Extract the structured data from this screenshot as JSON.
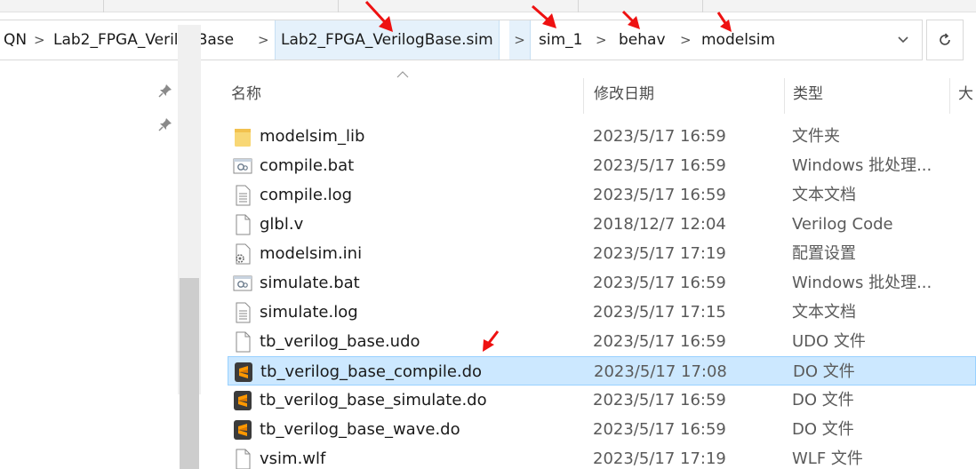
{
  "address_bar": {
    "crumbs": [
      {
        "label": "QN"
      },
      {
        "label": "Lab2_FPGA_VerilogBase"
      },
      {
        "label": "Lab2_FPGA_VerilogBase.sim"
      },
      {
        "label": "sim_1"
      },
      {
        "label": "behav"
      },
      {
        "label": "modelsim"
      }
    ],
    "separator": ">",
    "dropdown_icon": "chevron-down-icon",
    "refresh_icon": "refresh-icon"
  },
  "nav_pane": {
    "pin_icon": "pin-icon",
    "scroll_up_icon": "chevron-up-icon"
  },
  "columns": {
    "name": "名称",
    "date": "修改日期",
    "type": "类型",
    "size": "大"
  },
  "files": [
    {
      "name": "modelsim_lib",
      "date": "2023/5/17 16:59",
      "type": "文件夹",
      "icon": "folder-icon"
    },
    {
      "name": "compile.bat",
      "date": "2023/5/17 16:59",
      "type": "Windows 批处理...",
      "icon": "batch-file-icon"
    },
    {
      "name": "compile.log",
      "date": "2023/5/17 16:59",
      "type": "文本文档",
      "icon": "text-file-icon"
    },
    {
      "name": "glbl.v",
      "date": "2018/12/7 12:04",
      "type": "Verilog Code",
      "icon": "file-icon"
    },
    {
      "name": "modelsim.ini",
      "date": "2023/5/17 17:19",
      "type": "配置设置",
      "icon": "settings-file-icon"
    },
    {
      "name": "simulate.bat",
      "date": "2023/5/17 16:59",
      "type": "Windows 批处理...",
      "icon": "batch-file-icon"
    },
    {
      "name": "simulate.log",
      "date": "2023/5/17 17:15",
      "type": "文本文档",
      "icon": "text-file-icon"
    },
    {
      "name": "tb_verilog_base.udo",
      "date": "2023/5/17 16:59",
      "type": "UDO 文件",
      "icon": "file-icon"
    },
    {
      "name": "tb_verilog_base_compile.do",
      "date": "2023/5/17 17:08",
      "type": "DO 文件",
      "icon": "sublime-file-icon",
      "selected": true
    },
    {
      "name": "tb_verilog_base_simulate.do",
      "date": "2023/5/17 16:59",
      "type": "DO 文件",
      "icon": "sublime-file-icon"
    },
    {
      "name": "tb_verilog_base_wave.do",
      "date": "2023/5/17 16:59",
      "type": "DO 文件",
      "icon": "sublime-file-icon"
    },
    {
      "name": "vsim.wlf",
      "date": "2023/5/17 17:19",
      "type": "WLF 文件",
      "icon": "file-icon"
    }
  ],
  "colors": {
    "selection_bg": "#cce8ff",
    "selection_border": "#99d1ff",
    "crumb_highlight": "#e5f1fb",
    "annotation_arrow": "#ee1111",
    "folder": "#f8d775",
    "sublime_icon": "#ff9800"
  }
}
